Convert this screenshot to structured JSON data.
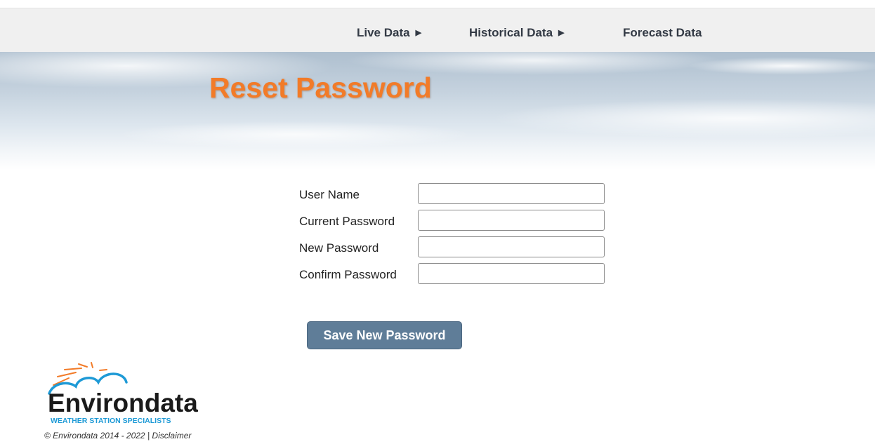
{
  "nav": {
    "items": [
      {
        "label": "Live Data",
        "has_arrow": true
      },
      {
        "label": "Historical Data",
        "has_arrow": true
      },
      {
        "label": "Forecast Data",
        "has_arrow": false
      }
    ],
    "arrow_glyph": "▶"
  },
  "page": {
    "title": "Reset Password"
  },
  "form": {
    "fields": [
      {
        "label": "User Name",
        "value": "",
        "type": "text"
      },
      {
        "label": "Current Password",
        "value": "",
        "type": "password"
      },
      {
        "label": "New Password",
        "value": "",
        "type": "password"
      },
      {
        "label": "Confirm Password",
        "value": "",
        "type": "password"
      }
    ],
    "submit_label": "Save New Password"
  },
  "logo": {
    "name": "Environdata",
    "tagline": "WEATHER STATION SPECIALISTS"
  },
  "footer": {
    "copyright": "© Environdata 2014 - 2022",
    "separator": "|",
    "disclaimer_label": "Disclaimer"
  },
  "colors": {
    "title": "#f27b28",
    "button": "#5f7d98",
    "nav_bar": "#f0f0f0",
    "logo_blue": "#1e9ad6"
  }
}
